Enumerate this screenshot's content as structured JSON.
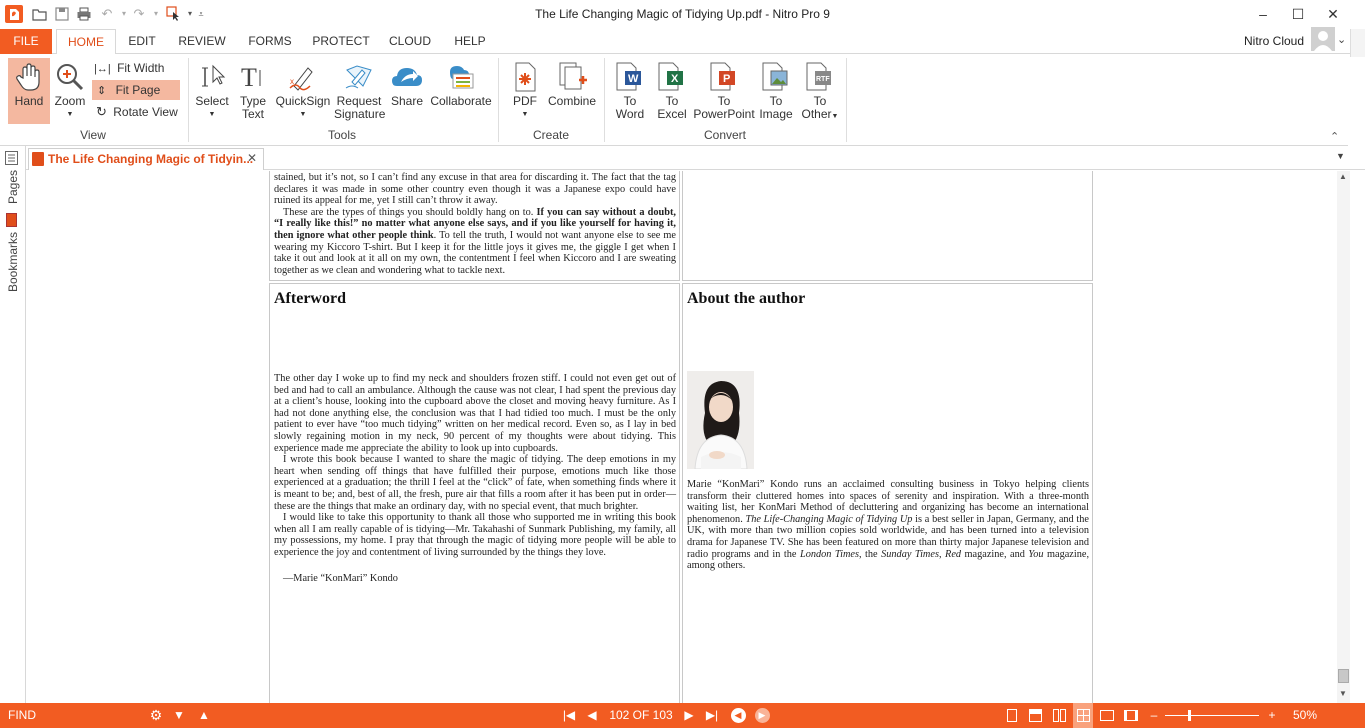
{
  "window": {
    "title": "The Life Changing Magic of Tidying Up.pdf - Nitro Pro 9",
    "user": "Nitro Cloud"
  },
  "menu": {
    "file": "FILE",
    "tabs": [
      "HOME",
      "EDIT",
      "REVIEW",
      "FORMS",
      "PROTECT",
      "CLOUD",
      "HELP"
    ]
  },
  "ribbon": {
    "view": {
      "hand": "Hand",
      "zoom": "Zoom",
      "fit_width": "Fit Width",
      "fit_page": "Fit Page",
      "rotate_view": "Rotate View",
      "label": "View"
    },
    "tools": {
      "select": "Select",
      "type_text_1": "Type",
      "type_text_2": "Text",
      "quicksign": "QuickSign",
      "request_sig_1": "Request",
      "request_sig_2": "Signature",
      "share": "Share",
      "collaborate": "Collaborate",
      "label": "Tools"
    },
    "create": {
      "pdf": "PDF",
      "combine": "Combine",
      "label": "Create"
    },
    "convert": {
      "to": "To",
      "word": "Word",
      "excel": "Excel",
      "powerpoint": "PowerPoint",
      "image": "Image",
      "other": "Other",
      "label": "Convert"
    }
  },
  "document_tab": "The Life Changing Magic of Tidyin...",
  "left_panel": {
    "pages": "Pages",
    "bookmarks": "Bookmarks"
  },
  "document": {
    "top_left": {
      "p1": "stained, but it’s not, so I can’t find any excuse in that area for discarding it. The fact that the tag declares it was made in some other country even though it was a Japanese expo could have ruined its appeal for me, yet I still can’t throw it away.",
      "p2_a": "These are the types of things you should boldly hang on to. ",
      "p2_bold": "If you can say without a doubt, “I really like this!” no matter what anyone else says, and if you like yourself for having it, then ignore what other people think",
      "p2_b": ". To tell the truth, I would not want anyone else to see me wearing my Kiccoro T-shirt. But I keep it for the little joys it gives me, the giggle I get when I take it out and look at it all on my own, the contentment I feel when Kiccoro and I are sweating together as we clean and wondering what to tackle next."
    },
    "afterword": {
      "heading": "Afterword",
      "p1": "The other day I woke up to find my neck and shoulders frozen stiff. I could not even get out of bed and had to call an ambulance. Although the cause was not clear, I had spent the previous day at a client’s house, looking into the cupboard above the closet and moving heavy furniture. As I had not done anything else, the conclusion was that I had tidied too much. I must be the only patient to ever have “too much tidying” written on her medical record. Even so, as I lay in bed slowly regaining motion in my neck, 90 percent of my thoughts were about tidying. This experience made me appreciate the ability to look up into cupboards.",
      "p2": "I wrote this book because I wanted to share the magic of tidying. The deep emotions in my heart when sending off things that have fulfilled their purpose, emotions much like those experienced at a graduation; the thrill I feel at the “click” of fate, when something finds where it is meant to be; and, best of all, the fresh, pure air that fills a room after it has been put in order—these are the things that make an ordinary day, with no special event, that much brighter.",
      "p3": "I would like to take this opportunity to thank all those who supported me in writing this book when all I am really capable of is tidying—Mr. Takahashi of Sunmark Publishing, my family, all my possessions, my home. I pray that through the magic of tidying more people will be able to experience the joy and contentment of living surrounded by the things they love.",
      "signature": "—Marie “KonMari” Kondo"
    },
    "about": {
      "heading": "About the author",
      "p1_a": "Marie “KonMari” Kondo runs an acclaimed consulting business in Tokyo helping clients transform their cluttered homes into spaces of serenity and inspiration. With a three-month waiting list, her KonMari Method of decluttering and organizing has become an international phenomenon. ",
      "p1_i1": "The Life-Changing Magic of Tidying Up",
      "p1_b": " is a best seller in Japan, Germany, and the UK, with more than two million copies sold worldwide, and has been turned into a television drama for Japanese TV. She has been featured on more than thirty major Japanese television and radio programs and in the ",
      "p1_i2": "London Times",
      "p1_c": ", the ",
      "p1_i3": "Sunday Times",
      "p1_d": ", ",
      "p1_i4": "Red",
      "p1_e": " magazine, and ",
      "p1_i5": "You",
      "p1_f": " magazine, among others."
    }
  },
  "status": {
    "find": "FIND",
    "page_indicator": "102 OF 103",
    "zoom": "50%"
  },
  "colors": {
    "accent": "#f25c22",
    "active_button": "#f4b8a0"
  }
}
